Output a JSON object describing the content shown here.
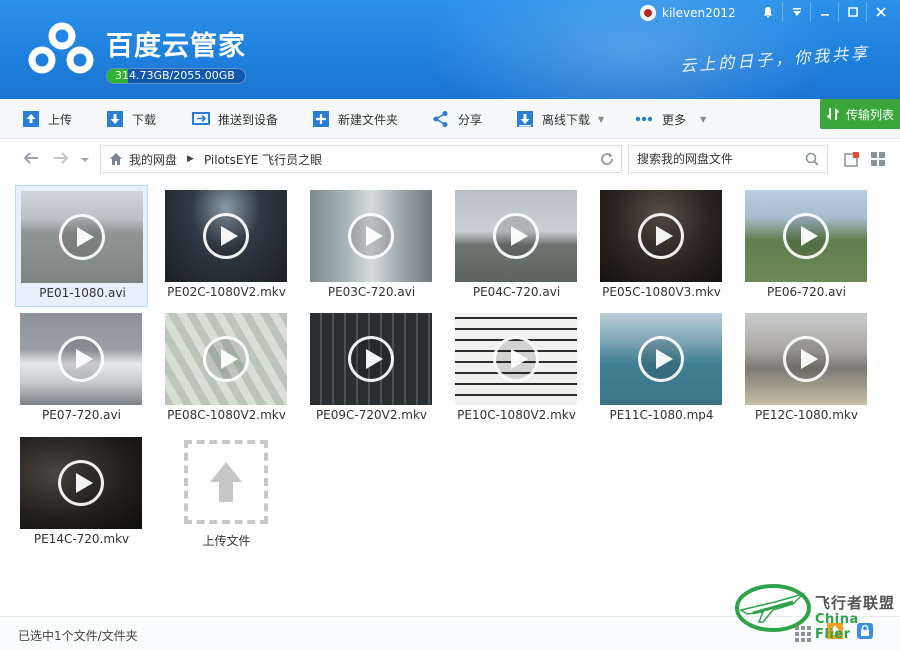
{
  "header": {
    "app_title": "百度云管家",
    "quota_text": "314.73GB/2055.00GB",
    "quota_used_fraction": 0.153,
    "slogan": "云上的日子，你我共享",
    "username": "kileven2012"
  },
  "toolbar": {
    "upload": "上传",
    "download": "下载",
    "push_to_device": "推送到设备",
    "new_folder": "新建文件夹",
    "share": "分享",
    "offline_download": "离线下载",
    "more": "更多",
    "transfer_list": "传输列表"
  },
  "breadcrumb": {
    "root": "我的网盘",
    "current": "PilotsEYE 飞行员之眼"
  },
  "search": {
    "placeholder": "搜索我的网盘文件"
  },
  "files": [
    {
      "name": "PE01-1080.avi",
      "selected": true
    },
    {
      "name": "PE02C-1080V2.mkv"
    },
    {
      "name": "PE03C-720.avi"
    },
    {
      "name": "PE04C-720.avi"
    },
    {
      "name": "PE05C-1080V3.mkv"
    },
    {
      "name": "PE06-720.avi"
    },
    {
      "name": "PE07-720.avi"
    },
    {
      "name": "PE08C-1080V2.mkv"
    },
    {
      "name": "PE09C-720V2.mkv"
    },
    {
      "name": "PE10C-1080V2.mkv"
    },
    {
      "name": "PE11C-1080.mp4"
    },
    {
      "name": "PE12C-1080.mkv"
    },
    {
      "name": "PE14C-720.mkv"
    }
  ],
  "upload_tile": {
    "label": "上传文件"
  },
  "status": {
    "selection_text": "已选中1个文件/文件夹"
  },
  "watermark": {
    "zh": "飞行者联盟",
    "en": "China Flier"
  },
  "colors": {
    "header_blue": "#1f7fdc",
    "accent_green": "#3aa53a",
    "selection_bg": "#e6f1fc"
  }
}
